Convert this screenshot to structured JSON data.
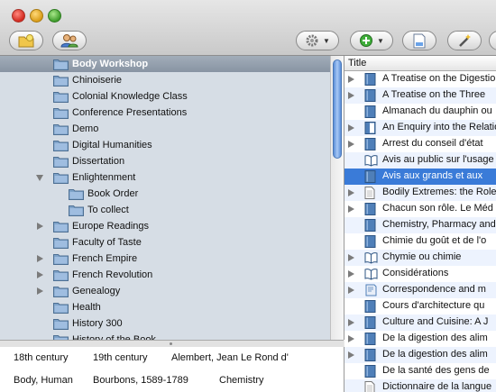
{
  "toolbar": {
    "buttons": [
      {
        "icon": "new-collection-icon"
      },
      {
        "icon": "new-group-icon"
      },
      {
        "icon": "gear-icon"
      },
      {
        "icon": "add-item-icon"
      },
      {
        "icon": "new-note-icon"
      },
      {
        "icon": "magic-wand-icon"
      }
    ]
  },
  "collections": {
    "rows": [
      {
        "label": "Body Workshop",
        "expander": "none",
        "selected": true,
        "indent": 0
      },
      {
        "label": "Chinoiserie",
        "expander": "none",
        "indent": 0
      },
      {
        "label": "Colonial Knowledge Class",
        "expander": "none",
        "indent": 0
      },
      {
        "label": "Conference Presentations",
        "expander": "none",
        "indent": 0
      },
      {
        "label": "Demo",
        "expander": "none",
        "indent": 0
      },
      {
        "label": "Digital Humanities",
        "expander": "none",
        "indent": 0
      },
      {
        "label": "Dissertation",
        "expander": "none",
        "indent": 0
      },
      {
        "label": "Enlightenment",
        "expander": "open",
        "indent": 0
      },
      {
        "label": "Book Order",
        "expander": "none",
        "indent": 1
      },
      {
        "label": "To collect",
        "expander": "none",
        "indent": 1
      },
      {
        "label": "Europe Readings",
        "expander": "closed",
        "indent": 0
      },
      {
        "label": "Faculty of Taste",
        "expander": "none",
        "indent": 0
      },
      {
        "label": "French Empire",
        "expander": "closed",
        "indent": 0
      },
      {
        "label": "French Revolution",
        "expander": "closed",
        "indent": 0
      },
      {
        "label": "Genealogy",
        "expander": "closed",
        "indent": 0
      },
      {
        "label": "Health",
        "expander": "none",
        "indent": 0
      },
      {
        "label": "History 300",
        "expander": "none",
        "indent": 0
      },
      {
        "label": "History of the Book",
        "expander": "none",
        "indent": 0
      }
    ]
  },
  "tags": [
    {
      "label": "18th century"
    },
    {
      "label": "19th century"
    },
    {
      "label": "Alembert, Jean Le Rond d'"
    },
    {
      "label": "Body, Human"
    },
    {
      "label": "Bourbons, 1589-1789"
    },
    {
      "label": "Chemistry"
    }
  ],
  "items": {
    "column_title": "Title",
    "rows": [
      {
        "title": "A Treatise on the Digestion",
        "expander": true,
        "type": "book"
      },
      {
        "title": "A Treatise on the Three",
        "expander": true,
        "type": "book"
      },
      {
        "title": "Almanach du dauphin ou",
        "expander": false,
        "type": "book"
      },
      {
        "title": "An Enquiry into the Relation",
        "expander": true,
        "type": "book-section"
      },
      {
        "title": "Arrest du conseil d'état",
        "expander": true,
        "type": "book"
      },
      {
        "title": "Avis au public sur l'usage",
        "expander": false,
        "type": "open-book"
      },
      {
        "title": "Avis aux grands et aux",
        "expander": false,
        "type": "book",
        "selected": true
      },
      {
        "title": "Bodily Extremes: the Role",
        "expander": true,
        "type": "document"
      },
      {
        "title": "Chacun son rôle. Le Méd",
        "expander": true,
        "type": "book"
      },
      {
        "title": "Chemistry, Pharmacy and",
        "expander": false,
        "type": "book"
      },
      {
        "title": "Chimie du goût et de l'o",
        "expander": false,
        "type": "book"
      },
      {
        "title": "Chymie ou chimie",
        "expander": true,
        "type": "open-book"
      },
      {
        "title": "Considérations",
        "expander": true,
        "type": "open-book"
      },
      {
        "title": "Correspondence and m",
        "expander": true,
        "type": "letter"
      },
      {
        "title": "Cours d'architecture qu",
        "expander": false,
        "type": "book"
      },
      {
        "title": "Culture and Cuisine: A J",
        "expander": true,
        "type": "book"
      },
      {
        "title": "De la digestion des alim",
        "expander": true,
        "type": "book"
      },
      {
        "title": "De la digestion des alim",
        "expander": true,
        "type": "book"
      },
      {
        "title": "De la santé des gens de",
        "expander": false,
        "type": "book"
      },
      {
        "title": "Dictionnaire de la langue",
        "expander": false,
        "type": "document"
      }
    ]
  },
  "colors": {
    "sidebar_bg": "#d6dde5",
    "selection_sidebar": "#8894a3",
    "selection_items": "#3a7bd8",
    "folder": "#7fa3c9",
    "book": "#4f7fb8"
  }
}
